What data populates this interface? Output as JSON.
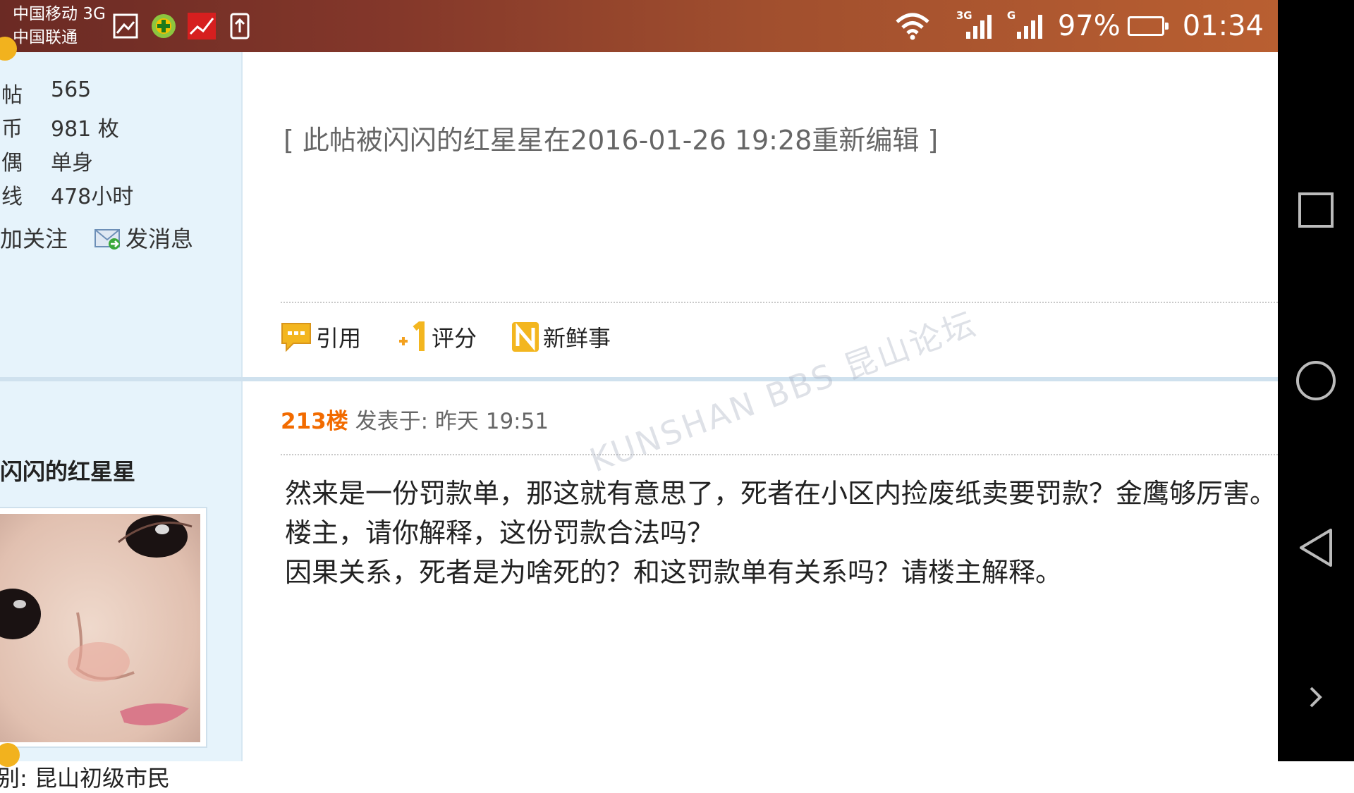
{
  "status_bar": {
    "carrier_1": "中国移动 3G",
    "carrier_2": "中国联通",
    "notification_icons": [
      "gallery-icon",
      "plus-app-icon",
      "news-app-icon",
      "upload-icon"
    ],
    "signal_1_label": "3G",
    "signal_2_label": "G",
    "battery_percent": "97%",
    "time": "01:34"
  },
  "user_stats": [
    {
      "label_fragment": "帖",
      "value": "565"
    },
    {
      "label_fragment": "币",
      "value": "981 枚"
    },
    {
      "label_fragment": "偶",
      "value": "单身"
    },
    {
      "label_fragment": "线",
      "value": "478小时"
    }
  ],
  "user_actions": {
    "follow": "加关注",
    "message": "发消息"
  },
  "edit_note": "[ 此帖被闪闪的红星星在2016-01-26 19:28重新编辑 ]",
  "toolbar": {
    "quote": "引用",
    "rate": "评分",
    "news": "新鲜事"
  },
  "post": {
    "author": "闪闪的红星星",
    "level": "级别: 昆山初级市民",
    "floor": "213楼",
    "posted_at": "发表于: 昨天 19:51",
    "lines": [
      "然来是一份罚款单，那这就有意思了，死者在小区内捡废纸卖要罚款？金鹰够厉害。",
      "楼主，请你解释，这份罚款合法吗？",
      "因果关系，死者是为啥死的？和这罚款单有关系吗？请楼主解释。"
    ]
  },
  "watermark": "KUNSHAN BBS 昆山论坛",
  "colors": {
    "status_bar_start": "#6b2a24",
    "status_bar_end": "#b95f31",
    "sidebar_bg": "#e6f3fb",
    "floor_number": "#f26b00",
    "nav_bar": "#000000"
  }
}
